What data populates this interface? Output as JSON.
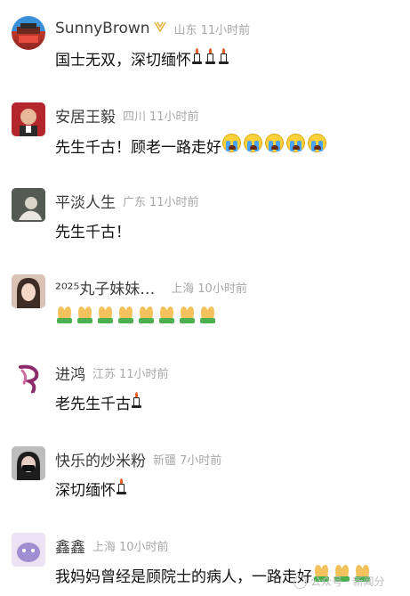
{
  "comments": [
    {
      "username": "SunnyBrown",
      "region": "山东",
      "time": "11小时前",
      "text": "国士无双，深切缅怀"
    },
    {
      "username": "安居王毅",
      "region": "四川",
      "time": "11小时前",
      "text": "先生千古！顾老一路走好"
    },
    {
      "username": "平淡人生",
      "region": "广东",
      "time": "11小时前",
      "text": "先生千古！"
    },
    {
      "username": "²⁰²⁵丸子妹妹…",
      "region": "上海",
      "time": "10小时前",
      "text": ""
    },
    {
      "username": "进鸿",
      "region": "江苏",
      "time": "11小时前",
      "text": "老先生千古"
    },
    {
      "username": "快乐的炒米粉",
      "region": "新疆",
      "time": "7小时前",
      "text": "深切缅怀"
    },
    {
      "username": "鑫鑫",
      "region": "上海",
      "time": "10小时前",
      "text": "我妈妈曾经是顾院士的病人，一路走好"
    }
  ],
  "watermark": "公众号 · 新闻分",
  "icons": {
    "badge": "vip-badge-icon",
    "candle": "candle-emoji",
    "cry": "loudly-crying-emoji",
    "pray": "folded-hands-emoji"
  }
}
